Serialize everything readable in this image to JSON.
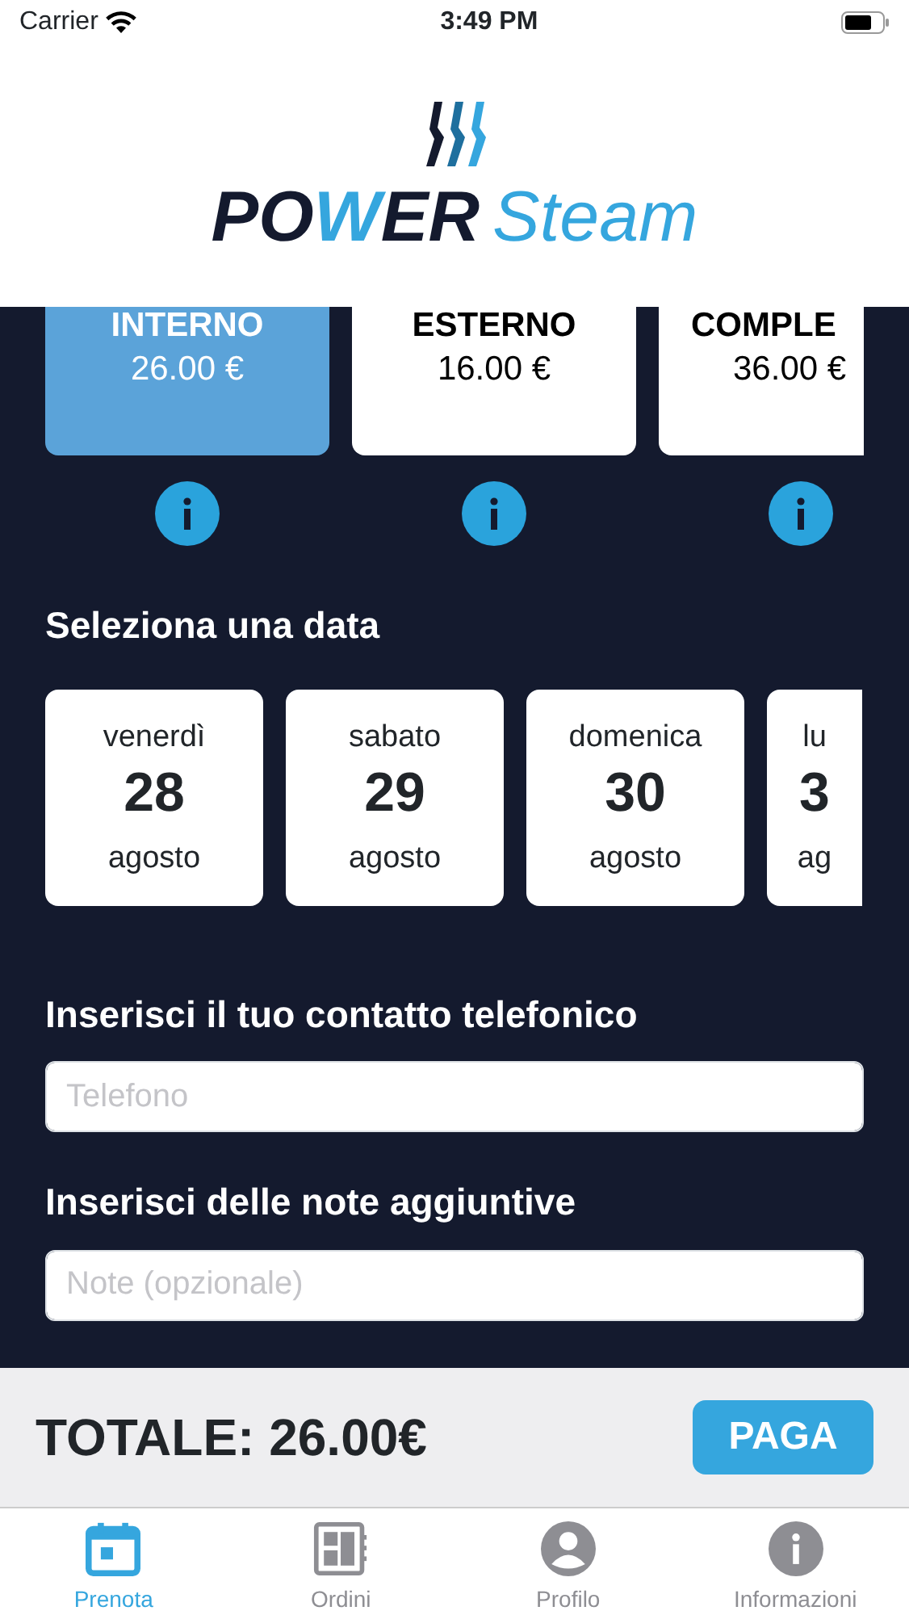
{
  "status_bar": {
    "carrier": "Carrier",
    "time": "3:49 PM"
  },
  "logo": {
    "parts": [
      {
        "text": "PO",
        "accent": false
      },
      {
        "text": "W",
        "accent": true
      },
      {
        "text": "ER",
        "accent": false
      }
    ],
    "light": "Steam"
  },
  "services": [
    {
      "name": "INTERNO",
      "price": "26.00 €",
      "selected": true
    },
    {
      "name": "ESTERNO",
      "price": "16.00 €",
      "selected": false
    },
    {
      "name": "COMPLE",
      "price": "36.00 €",
      "selected": false
    }
  ],
  "date_heading": "Seleziona una data",
  "dates": [
    {
      "weekday": "venerdì",
      "day": "28",
      "month": "agosto",
      "selected": false
    },
    {
      "weekday": "sabato",
      "day": "29",
      "month": "agosto",
      "selected": false
    },
    {
      "weekday": "domenica",
      "day": "30",
      "month": "agosto",
      "selected": false
    },
    {
      "weekday": "lu",
      "day": "3",
      "month": "ag",
      "selected": false
    }
  ],
  "phone": {
    "label": "Inserisci il tuo contatto telefonico",
    "placeholder": "Telefono"
  },
  "notes": {
    "label": "Inserisci delle note aggiuntive",
    "placeholder": "Note (opzionale)"
  },
  "footer": {
    "total": "TOTALE: 26.00€",
    "button": "PAGA"
  },
  "tabs": [
    {
      "kind": "calendar",
      "label": "Prenota",
      "selected": true
    },
    {
      "kind": "orders",
      "label": "Ordini",
      "selected": false
    },
    {
      "kind": "profile",
      "label": "Profilo",
      "selected": false
    },
    {
      "kind": "info",
      "label": "Informazioni",
      "selected": false
    }
  ]
}
